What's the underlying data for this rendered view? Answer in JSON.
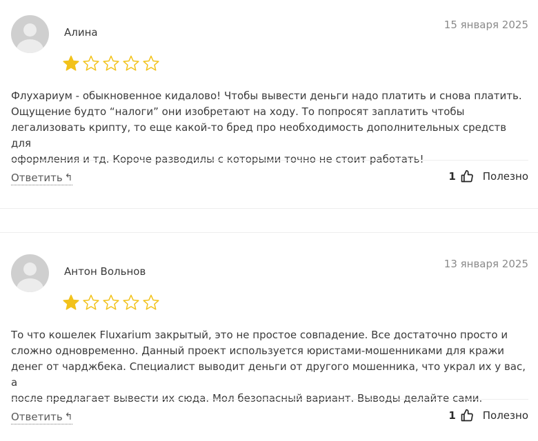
{
  "colors": {
    "star_filled": "#f2c21b",
    "star_empty_stroke": "#f2c21b",
    "date_text": "#8a8a8a",
    "body_text": "#3a3a3a"
  },
  "reviews": [
    {
      "author": "Алина",
      "date": "15 января 2025",
      "rating": 1,
      "max_rating": 5,
      "text_lines": [
        "Флухариум - обыкновенное кидалово! Чтобы вывести деньги надо платить и снова платить.",
        "Ощущение будто “налоги” они изобретают на ходу. То попросят заплатить чтобы",
        "легализовать крипту, то еще какой-то бред про необходимость дополнительных средств для",
        "оформления и тд. Короче разводилы с которыми точно не стоит работать!"
      ],
      "reply_label": "Ответить",
      "reply_icon": "reply-arrow-icon",
      "helpful_count": "1",
      "helpful_icon": "thumbs-up-icon",
      "helpful_label": "Полезно"
    },
    {
      "author": "Антон Вольнов",
      "date": "13 января 2025",
      "rating": 1,
      "max_rating": 5,
      "text_lines": [
        "То что кошелек Fluxarium закрытый, это не простое совпадение. Все достаточно просто и",
        "сложно одновременно. Данный проект используется юристами-мошенниками для кражи",
        "денег от чарджбека. Специалист выводит деньги от другого мошенника, что украл их у вас, а",
        "после предлагает вывести их сюда. Мол безопасный вариант. Выводы делайте сами."
      ],
      "reply_label": "Ответить",
      "reply_icon": "reply-arrow-icon",
      "helpful_count": "1",
      "helpful_icon": "thumbs-up-icon",
      "helpful_label": "Полезно"
    }
  ]
}
